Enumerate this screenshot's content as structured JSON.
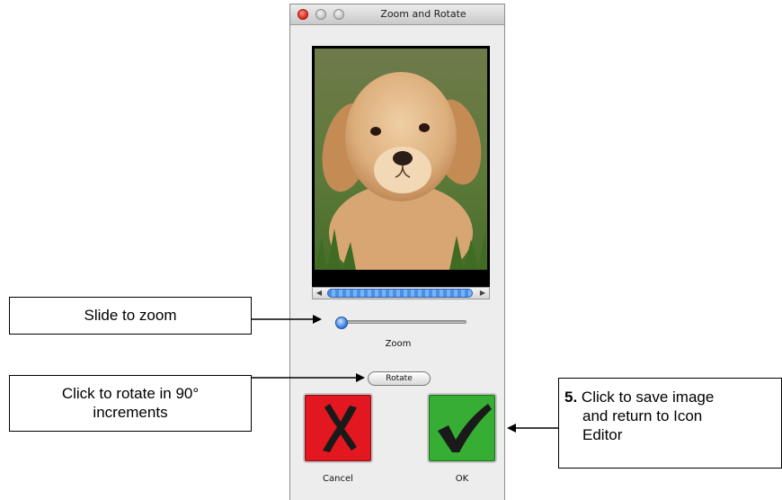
{
  "window": {
    "title": "Zoom and Rotate",
    "traffic_lights": [
      "close",
      "minimize",
      "zoom"
    ]
  },
  "preview": {
    "image_subject": "golden retriever puppy"
  },
  "zoom": {
    "label": "Zoom",
    "slider_value": 0
  },
  "rotate": {
    "label": "Rotate"
  },
  "buttons": {
    "cancel": {
      "label": "Cancel",
      "icon": "x-mark-icon",
      "color": "#e2171f"
    },
    "ok": {
      "label": "OK",
      "icon": "checkmark-icon",
      "color": "#36ad33"
    }
  },
  "callouts": {
    "zoom": "Slide to zoom",
    "rotate_line1": "Click to rotate in 90°",
    "rotate_line2": "increments",
    "ok_number": "5.",
    "ok_line1": "Click to save image",
    "ok_line2": "and return to Icon",
    "ok_line3": "Editor"
  }
}
